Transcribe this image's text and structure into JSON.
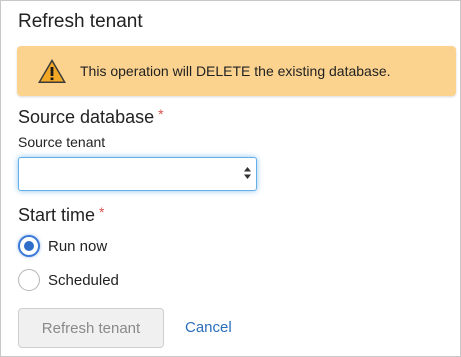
{
  "dialog": {
    "title": "Refresh tenant",
    "warning": {
      "icon": "warning-triangle-icon",
      "text": "This operation will DELETE the existing database."
    },
    "source_section": {
      "heading": "Source database",
      "required_marker": "*",
      "field_label": "Source tenant",
      "select_value": ""
    },
    "start_section": {
      "heading": "Start time",
      "required_marker": "*",
      "options": [
        {
          "label": "Run now",
          "selected": true
        },
        {
          "label": "Scheduled",
          "selected": false
        }
      ]
    },
    "actions": {
      "submit_label": "Refresh tenant",
      "cancel_label": "Cancel"
    }
  },
  "colors": {
    "warning_bg": "#fbd38f",
    "required": "#d9534f",
    "link": "#2a6fbd",
    "radio_selected": "#2e6ec8"
  }
}
